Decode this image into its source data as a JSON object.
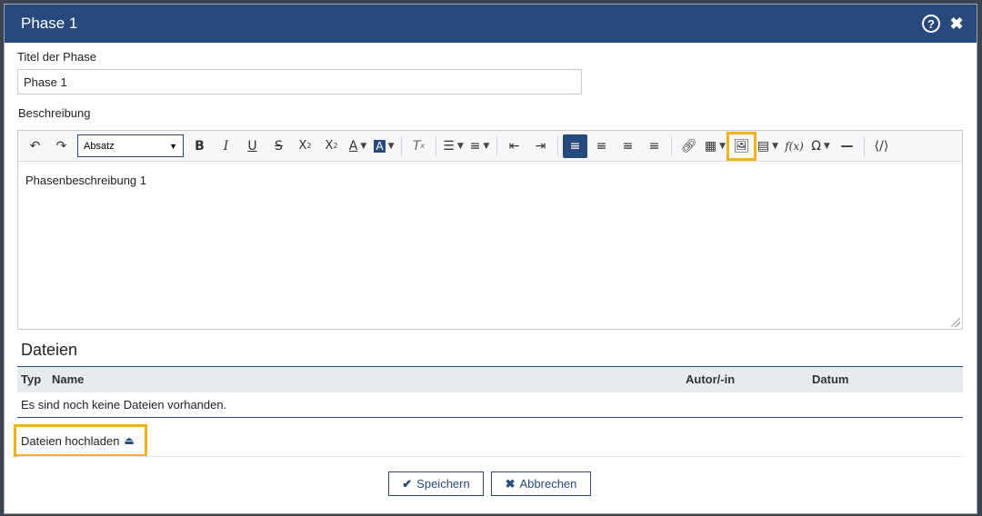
{
  "dialog": {
    "title": "Phase 1",
    "help_icon": "?",
    "close_icon": "✖"
  },
  "form": {
    "title_label": "Titel der Phase",
    "title_value": "Phase 1",
    "description_label": "Beschreibung"
  },
  "toolbar": {
    "paragraph_select": "Absatz",
    "icons": [
      "undo-icon",
      "redo-icon",
      "bold-icon",
      "italic-icon",
      "underline-icon",
      "strikethrough-icon",
      "subscript-icon",
      "superscript-icon",
      "font-color-icon",
      "background-color-icon",
      "remove-format-icon",
      "bulleted-list-icon",
      "numbered-list-icon",
      "outdent-icon",
      "indent-icon",
      "align-left-icon",
      "align-right-icon",
      "align-center-icon",
      "justify-icon",
      "link-icon",
      "table-icon",
      "image-icon",
      "media-icon",
      "formula-icon",
      "special-characters-icon",
      "horizontal-line-icon",
      "source-icon"
    ]
  },
  "editor": {
    "content": "Phasenbeschreibung 1"
  },
  "files": {
    "section_title": "Dateien",
    "columns": [
      "Typ",
      "Name",
      "Autor/-in",
      "Datum"
    ],
    "empty_message": "Es sind noch keine Dateien vorhanden.",
    "upload_label": "Dateien hochladen"
  },
  "actions": {
    "save_label": "Speichern",
    "cancel_label": "Abbrechen"
  },
  "colors": {
    "primary": "#28497c",
    "highlight": "#f1b21a"
  }
}
